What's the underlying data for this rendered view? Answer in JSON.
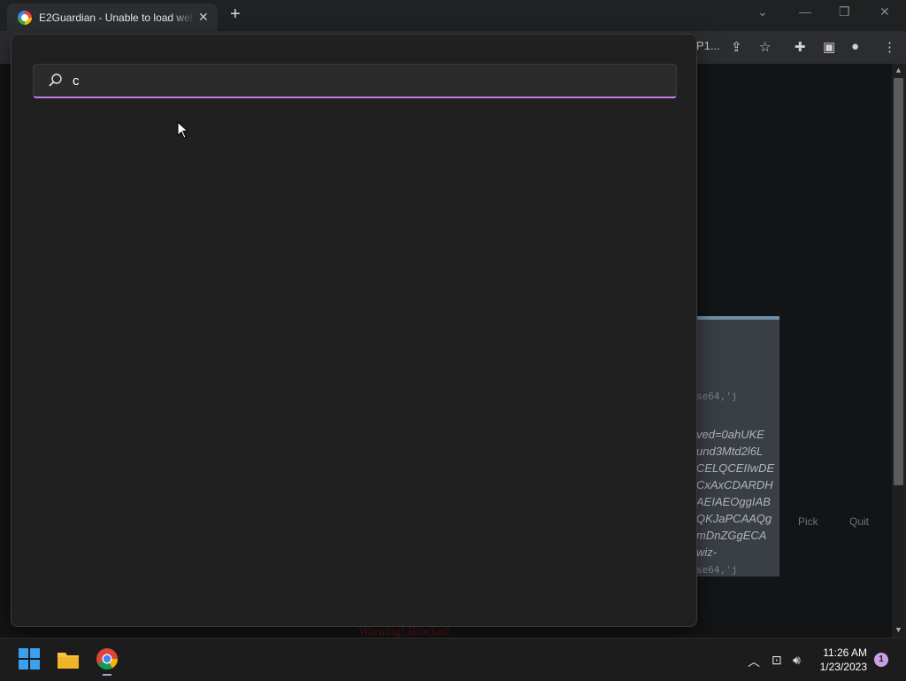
{
  "browser": {
    "tab_title": "E2Guardian - Unable to load web",
    "tab_close": "✕",
    "new_tab": "+",
    "address_fragment": "P1..."
  },
  "search": {
    "query": "c"
  },
  "background_page": {
    "code_lines_top": "se64,'j",
    "italic_lines": [
      "ved=0ahUKE",
      "und3Mtd2l6L",
      "CELQCEIIwDE",
      "CxAxCDARDH",
      "AEIAEOggIAB",
      "QKJaPCAAQg",
      "mDnZGgECA",
      "wiz-"
    ],
    "code_lines_bottom": "se64,'j",
    "pick_label": "Pick",
    "quit_label": "Quit",
    "red_text": "Warning! Blocked"
  },
  "taskbar": {
    "time": "11:26 AM",
    "date": "1/23/2023",
    "notifications": "1"
  }
}
